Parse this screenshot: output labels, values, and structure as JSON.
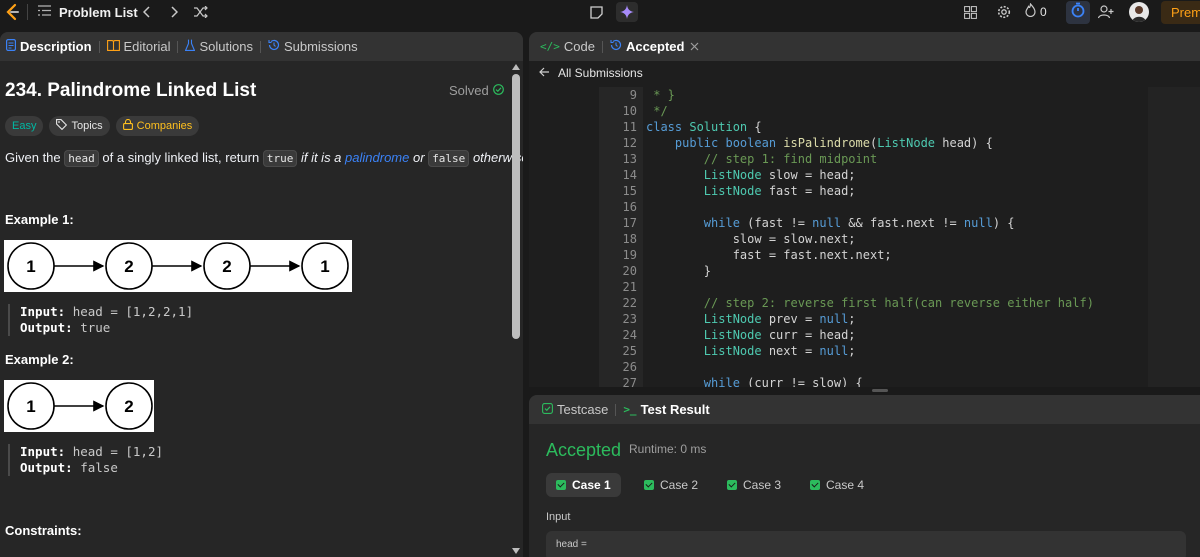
{
  "topbar": {
    "problem_list": "Problem List",
    "streak_count": "0",
    "premium_label": "Prem"
  },
  "left_panel": {
    "tabs": [
      "Description",
      "Editorial",
      "Solutions",
      "Submissions"
    ],
    "title": "234. Palindrome Linked List",
    "solved_label": "Solved",
    "tags": {
      "difficulty": "Easy",
      "topics": "Topics",
      "companies": "Companies"
    },
    "description": {
      "t1": "Given the",
      "c1": "head",
      "t2": "of a singly linked list, return",
      "c2": "true",
      "t3": "if it is a",
      "link": "palindrome",
      "t4": "or",
      "c3": "false",
      "t5": "otherwise."
    },
    "example1": {
      "heading": "Example 1:",
      "nodes": [
        "1",
        "2",
        "2",
        "1"
      ],
      "input_label": "Input:",
      "input_value": "head = [1,2,2,1]",
      "output_label": "Output:",
      "output_value": "true"
    },
    "example2": {
      "heading": "Example 2:",
      "nodes": [
        "1",
        "2"
      ],
      "input_label": "Input:",
      "input_value": "head = [1,2]",
      "output_label": "Output:",
      "output_value": "false"
    },
    "constraints_heading": "Constraints:"
  },
  "code_panel": {
    "tabs": {
      "code": "Code",
      "accepted": "Accepted"
    },
    "back_label": "All Submissions",
    "line_numbers": [
      "9",
      "10",
      "11",
      "12",
      "13",
      "14",
      "15",
      "16",
      "17",
      "18",
      "19",
      "20",
      "21",
      "22",
      "23",
      "24",
      "25",
      "26",
      "27"
    ]
  },
  "result_panel": {
    "tabs": {
      "testcase": "Testcase",
      "test_result": "Test Result"
    },
    "status": "Accepted",
    "runtime": "Runtime: 0 ms",
    "cases": [
      "Case 1",
      "Case 2",
      "Case 3",
      "Case 4"
    ],
    "input_label": "Input",
    "input_value": "head ="
  },
  "colors": {
    "accepted_green": "#2cbb5d",
    "easy_teal": "#00b8a3",
    "companies_amber": "#ffc01e",
    "link_blue": "#3b82f6",
    "premium_orange": "#ffa116"
  }
}
